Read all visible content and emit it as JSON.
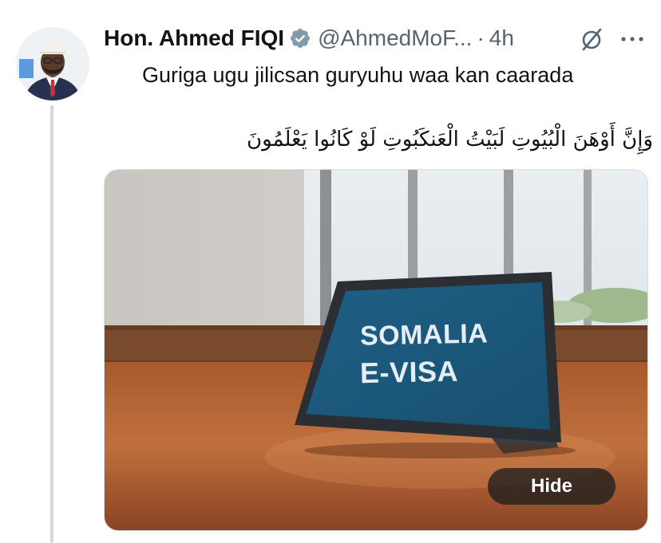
{
  "tweet": {
    "author_name": "Hon. Ahmed FIQI",
    "handle": "@AhmedMoF...",
    "separator": "·",
    "time": "4h",
    "text_line_1": "Guriga ugu jilicsan guryuhu waa kan caarada",
    "text_line_2": "وَإِنَّ أَوْهَنَ الْبُيُوتِ لَبَيْتُ الْعَنكَبُوتِ لَوْ كَانُوا يَعْلَمُونَ",
    "icons": {
      "verified": "verified-badge-icon",
      "mute": "mute-icon",
      "more": "more-options-icon"
    }
  },
  "media": {
    "tablet_line_1": "SOMALIA",
    "tablet_line_2": "E-VISA",
    "hide_label": "Hide"
  },
  "colors": {
    "text_primary": "#0f1419",
    "text_secondary": "#536471",
    "thread_line": "#cfd9de",
    "verified_badge": "#829aab"
  }
}
